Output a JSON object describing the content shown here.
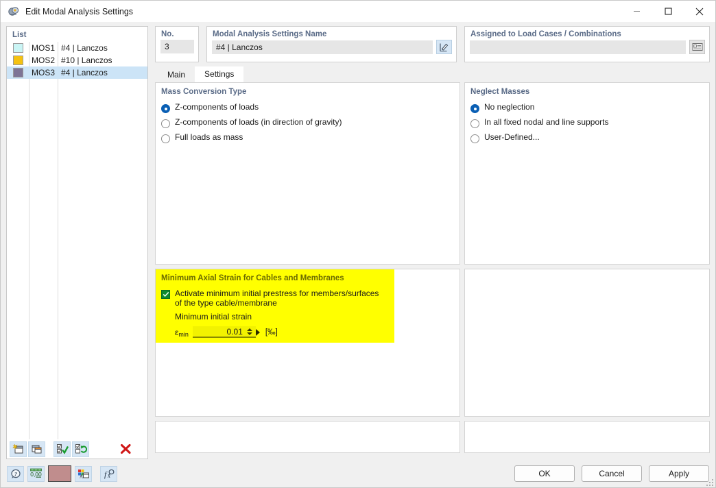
{
  "window": {
    "title": "Edit Modal Analysis Settings",
    "icon": "modal-analysis-icon",
    "minimize": "–",
    "maximize": "□",
    "close": "✕"
  },
  "list": {
    "header": "List",
    "rows": [
      {
        "color": "#caf5f5",
        "id": "MOS1",
        "desc": "#4 | Lanczos",
        "selected": false
      },
      {
        "color": "#f5c211",
        "id": "MOS2",
        "desc": "#10 | Lanczos",
        "selected": false
      },
      {
        "color": "#7d7496",
        "id": "MOS3",
        "desc": "#4 | Lanczos",
        "selected": true
      }
    ],
    "toolbar": [
      {
        "name": "new-item-button",
        "glyph": "new"
      },
      {
        "name": "copy-item-button",
        "glyph": "copy"
      },
      {
        "name": "select-all-button",
        "glyph": "check-all"
      },
      {
        "name": "invert-selection-button",
        "glyph": "invert"
      },
      {
        "name": "delete-item-button",
        "glyph": "delete"
      }
    ]
  },
  "no_card": {
    "label": "No.",
    "value": "3"
  },
  "name_card": {
    "label": "Modal Analysis Settings Name",
    "value": "#4 | Lanczos",
    "edit_button": "edit-name-button"
  },
  "assigned_card": {
    "label": "Assigned to Load Cases / Combinations",
    "value": "",
    "placeholder": "",
    "picker_button": "load-case-picker-button"
  },
  "tabs": [
    {
      "label": "Main",
      "active": false
    },
    {
      "label": "Settings",
      "active": true
    }
  ],
  "mass_conversion": {
    "title": "Mass Conversion Type",
    "options": [
      {
        "label": "Z-components of loads",
        "checked": true
      },
      {
        "label": "Z-components of loads (in direction of gravity)",
        "checked": false
      },
      {
        "label": "Full loads as mass",
        "checked": false
      }
    ]
  },
  "neglect_masses": {
    "title": "Neglect Masses",
    "options": [
      {
        "label": "No neglection",
        "checked": true
      },
      {
        "label": "In all fixed nodal and line supports",
        "checked": false
      },
      {
        "label": "User-Defined...",
        "checked": false
      }
    ]
  },
  "min_axial_strain": {
    "title": "Minimum Axial Strain for Cables and Membranes",
    "highlight_color": "#ffff00",
    "checkbox_checked": true,
    "checkbox_label_line1": "Activate minimum initial prestress for members/surfaces",
    "checkbox_label_line2": "of the type cable/membrane",
    "sub_label": "Minimum initial strain",
    "field_symbol": "ε",
    "field_subscript": "min",
    "field_value": "0.01",
    "field_unit": "[‰]"
  },
  "bottom_bar": {
    "icons": [
      {
        "name": "help-button",
        "glyph": "help"
      },
      {
        "name": "decimal-places-button",
        "glyph": "0,00"
      },
      {
        "name": "color-swatch-button",
        "glyph": "color",
        "color": "#c08d8d"
      },
      {
        "name": "display-properties-button",
        "glyph": "display"
      },
      {
        "name": "formula-button",
        "glyph": "fx"
      }
    ],
    "buttons": [
      {
        "label": "OK",
        "name": "ok-button"
      },
      {
        "label": "Cancel",
        "name": "cancel-button"
      },
      {
        "label": "Apply",
        "name": "apply-button"
      }
    ]
  }
}
